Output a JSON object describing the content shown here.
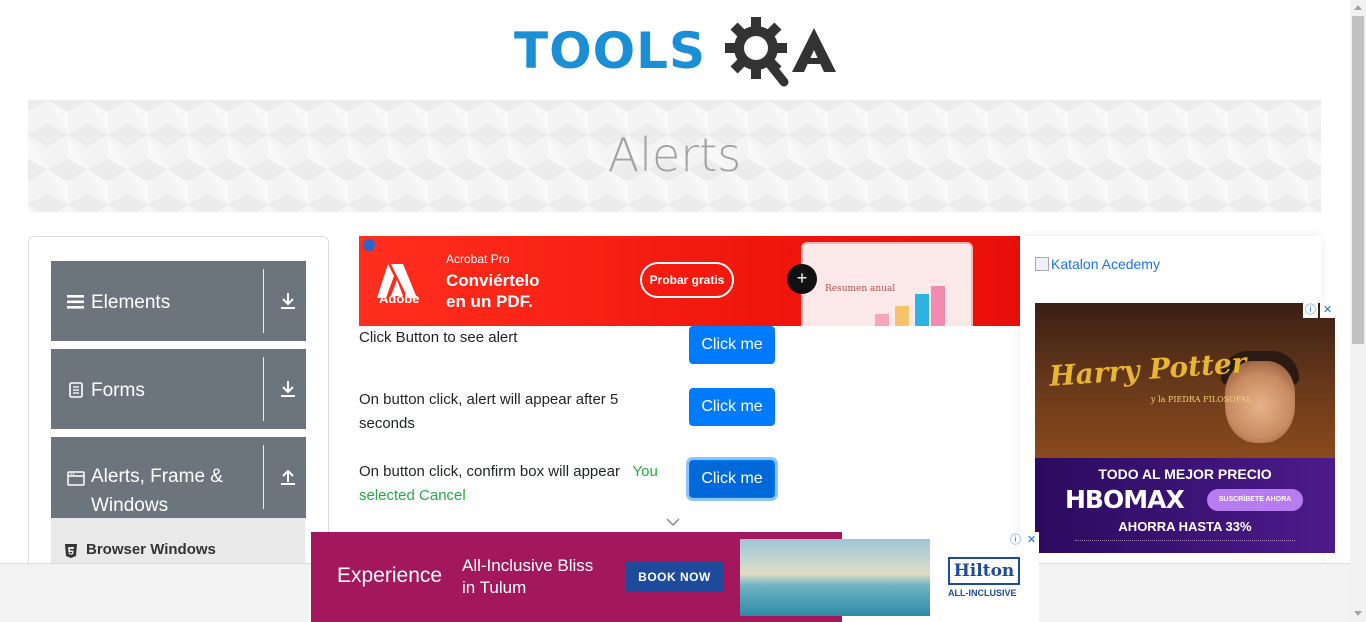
{
  "header": {
    "logo_text": "TOOLS",
    "logo_qa_text": "QA"
  },
  "banner": {
    "title": "Alerts"
  },
  "sidebar": {
    "groups": [
      {
        "label": "Elements",
        "icon": "hamburger-icon",
        "arrow": "download-icon"
      },
      {
        "label": "Forms",
        "icon": "document-icon",
        "arrow": "download-icon"
      },
      {
        "label": "Alerts, Frame & Windows",
        "icon": "window-icon",
        "arrow": "upload-icon"
      }
    ],
    "sub_items": [
      {
        "label": "Browser Windows",
        "icon": "html5-icon"
      }
    ]
  },
  "top_ad": {
    "brand": "Adobe",
    "product": "Acrobat Pro",
    "headline_line1": "Conviértelo",
    "headline_line2": "en un PDF.",
    "cta": "Probar gratis",
    "mock_title": "Resumen anual"
  },
  "alerts": [
    {
      "text": "Click Button to see alert",
      "button": "Click me"
    },
    {
      "text": "On button click, alert will appear after 5 seconds",
      "button": "Click me"
    },
    {
      "text": "On button click, confirm box will appear",
      "button": "Click me",
      "result": "You selected Cancel"
    }
  ],
  "right_ads": {
    "katalon_alt": "Katalon Acedemy",
    "hbo": {
      "movie_title": "Harry Potter",
      "movie_subtitle": "y la PIEDRA FILOSOFAL",
      "line1": "TODO AL MEJOR PRECIO",
      "logo": "HBOMAX",
      "cta": "SUSCRÍBETE AHORA",
      "line2": "AHORRA HASTA 33%"
    }
  },
  "bottom_ad": {
    "experience": "Experience",
    "bliss_line1": "All-Inclusive Bliss",
    "bliss_line2": "in Tulum",
    "cta": "BOOK NOW",
    "brand": "Hilton",
    "brand_sub": "ALL-INCLUSIVE"
  },
  "colors": {
    "primary_button": "#007bff",
    "success_text": "#28a745",
    "sidebar_group": "#6c757d",
    "logo_blue": "#1a8fd6",
    "logo_dark": "#333333"
  }
}
